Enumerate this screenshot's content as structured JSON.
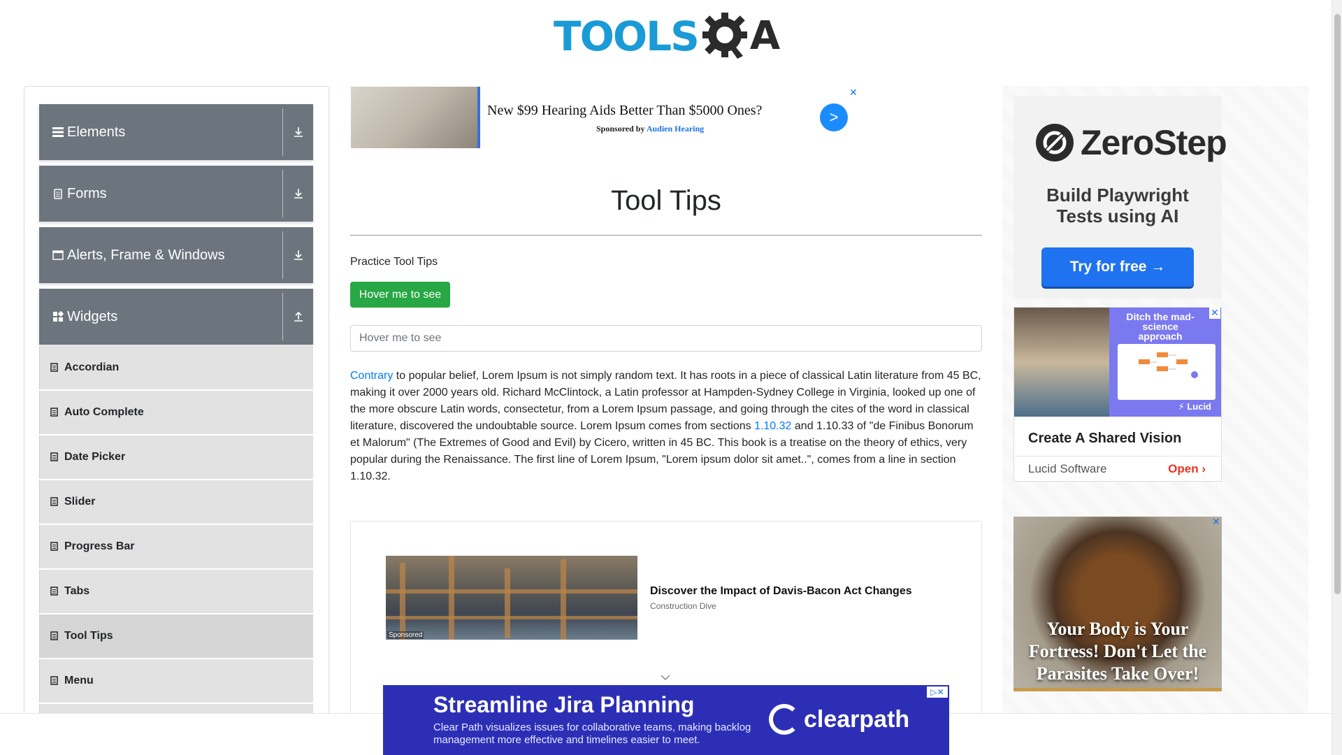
{
  "header": {
    "logo_text": "TOOLS",
    "logo_suffix": "A"
  },
  "sidebar": {
    "groups": [
      {
        "label": "Elements",
        "icon": "hamburger-icon",
        "arrow": "download-icon"
      },
      {
        "label": "Forms",
        "icon": "document-icon",
        "arrow": "download-icon"
      },
      {
        "label": "Alerts, Frame & Windows",
        "icon": "window-icon",
        "arrow": "download-icon"
      },
      {
        "label": "Widgets",
        "icon": "widgets-icon",
        "arrow": "upload-icon"
      }
    ],
    "items": [
      {
        "label": "Accordian"
      },
      {
        "label": "Auto Complete"
      },
      {
        "label": "Date Picker"
      },
      {
        "label": "Slider"
      },
      {
        "label": "Progress Bar"
      },
      {
        "label": "Tabs"
      },
      {
        "label": "Tool Tips"
      },
      {
        "label": "Menu"
      }
    ],
    "active_item": "Tool Tips"
  },
  "top_ad": {
    "title": "New $99 Hearing Aids Better Than $5000 Ones?",
    "sponsored_prefix": "Sponsored by",
    "sponsor": "Audien Hearing",
    "cta": ">",
    "close": "✕"
  },
  "main": {
    "title": "Tool Tips",
    "practice_label": "Practice Tool Tips",
    "hover_button": "Hover me to see",
    "hover_input_placeholder": "Hover me to see",
    "paragraph": {
      "link1": "Contrary",
      "text1": " to popular belief, Lorem Ipsum is not simply random text. It has roots in a piece of classical Latin literature from 45 BC, making it over 2000 years old. Richard McClintock, a Latin professor at Hampden-Sydney College in Virginia, looked up one of the more obscure Latin words, consectetur, from a Lorem Ipsum passage, and going through the cites of the word in classical literature, discovered the undoubtable source. Lorem Ipsum comes from sections ",
      "link2": "1.10.32",
      "text2": " and 1.10.33 of \"de Finibus Bonorum et Malorum\" (The Extremes of Good and Evil) by Cicero, written in 45 BC. This book is a treatise on the theory of ethics, very popular during the Renaissance. The first line of Lorem Ipsum, \"Lorem ipsum dolor sit amet..\", comes from a line in section 1.10.32."
    }
  },
  "content_ad": {
    "title": "Discover the Impact of Davis-Bacon Act Changes",
    "source": "Construction Dive",
    "sponsored": "Sponsored"
  },
  "right_ads": {
    "zerostep": {
      "name": "ZeroStep",
      "line1": "Build Playwright",
      "line2": "Tests using AI",
      "cta": "Try for free →"
    },
    "lucid": {
      "panel_text": "Ditch the mad-science approach",
      "brand": "⚡ Lucid",
      "headline": "Create A Shared Vision",
      "advertiser": "Lucid Software",
      "cta": "Open ›"
    },
    "parasite": {
      "text": "Your Body is Your Fortress! Don't Let the Parasites Take Over!"
    },
    "close": "✕"
  },
  "bottom_ad": {
    "title": "Streamline Jira Planning",
    "subtitle": "Clear Path visualizes issues for collaborative teams, making backlog management more effective and timelines easier to meet.",
    "brand": "clearpath",
    "close": "▷✕"
  },
  "colors": {
    "sidebar_group": "#6c757d",
    "sidebar_item": "#e2e2e2",
    "hover_button": "#28a745",
    "link": "#007bff",
    "logo_blue": "#1a9bd7"
  }
}
